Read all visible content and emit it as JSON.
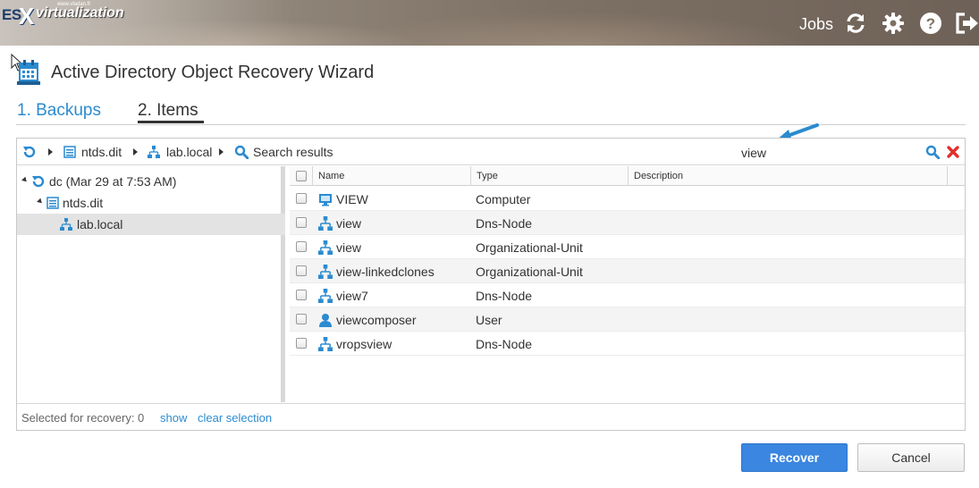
{
  "header": {
    "logo_es": "ES",
    "logo_x": "X",
    "logo_virt": "virtualization",
    "logo_site": "www.vladan.fr",
    "jobs_label": "Jobs",
    "icons": [
      "refresh-icon",
      "gear-icon",
      "help-icon",
      "logout-icon"
    ]
  },
  "wizard": {
    "title": "Active Directory Object Recovery Wizard",
    "steps": [
      {
        "label": "1. Backups",
        "active": false
      },
      {
        "label": "2. Items",
        "active": true
      }
    ]
  },
  "breadcrumb": {
    "items": [
      "ntds.dit",
      "lab.local",
      "Search results"
    ]
  },
  "search": {
    "value": "view",
    "placeholder": ""
  },
  "tree": {
    "items": [
      {
        "label": "dc (Mar 29 at 7:53 AM)",
        "level": 0,
        "icon": "restore-point-icon"
      },
      {
        "label": "ntds.dit",
        "level": 1,
        "icon": "database-file-icon"
      },
      {
        "label": "lab.local",
        "level": 2,
        "icon": "domain-icon",
        "selected": true
      }
    ]
  },
  "grid": {
    "columns": [
      "Name",
      "Type",
      "Description"
    ],
    "rows": [
      {
        "name": "VIEW",
        "type": "Computer",
        "description": "",
        "icon": "computer-icon"
      },
      {
        "name": "view",
        "type": "Dns-Node",
        "description": "",
        "icon": "dns-node-icon"
      },
      {
        "name": "view",
        "type": "Organizational-Unit",
        "description": "",
        "icon": "ou-icon"
      },
      {
        "name": "view-linkedclones",
        "type": "Organizational-Unit",
        "description": "",
        "icon": "ou-icon"
      },
      {
        "name": "view7",
        "type": "Dns-Node",
        "description": "",
        "icon": "dns-node-icon"
      },
      {
        "name": "viewcomposer",
        "type": "User",
        "description": "",
        "icon": "user-icon"
      },
      {
        "name": "vropsview",
        "type": "Dns-Node",
        "description": "",
        "icon": "dns-node-icon"
      }
    ]
  },
  "footer": {
    "selected_text": "Selected for recovery: 0",
    "show_link": "show",
    "clear_link": "clear selection"
  },
  "buttons": {
    "recover": "Recover",
    "cancel": "Cancel"
  },
  "colors": {
    "accent": "#2b8bd0",
    "recover_button": "#3a86e0",
    "clear_search": "#e0302a"
  }
}
